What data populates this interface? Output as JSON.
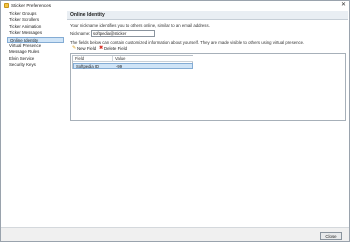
{
  "window": {
    "title": "Sticker Preferences",
    "app_icon": "sticker-app-icon",
    "close_glyph": "✕"
  },
  "sidebar": {
    "items": [
      {
        "label": "Ticker Groups",
        "selected": false
      },
      {
        "label": "Ticker Scrollers",
        "selected": false
      },
      {
        "label": "Ticker Animation",
        "selected": false
      },
      {
        "label": "Ticker Messages",
        "selected": false
      },
      {
        "label": "Online Identity",
        "selected": true
      },
      {
        "label": "Virtual Presence",
        "selected": false
      },
      {
        "label": "Message Rules",
        "selected": false
      },
      {
        "label": "Elvin Service",
        "selected": false
      },
      {
        "label": "Security Keys",
        "selected": false
      }
    ]
  },
  "main": {
    "header": "Online Identity",
    "description": "Your nickname identifies you to others online, similar to an email address.",
    "nickname_label": "Nickname:",
    "nickname_value": "softpedia@sticker",
    "fields_description": "The fields below can contain customized information about yourself. They are made visible to others using virtual presence.",
    "toolbar": {
      "new_field_label": "New Field",
      "new_field_icon": "new-field-icon",
      "delete_field_label": "Delete Field",
      "delete_field_icon": "delete-icon"
    },
    "table": {
      "columns": [
        "Field",
        "Value"
      ],
      "rows": [
        {
          "field": "Softpedia ID",
          "value": "-99"
        }
      ]
    }
  },
  "footer": {
    "close_label": "Close"
  },
  "colors": {
    "selection": "#cfe4f7",
    "selection_border": "#84acd4",
    "header_band": "#e9eef3",
    "delete_icon": "#d9342b",
    "new_field_icon": "#e0a526"
  }
}
